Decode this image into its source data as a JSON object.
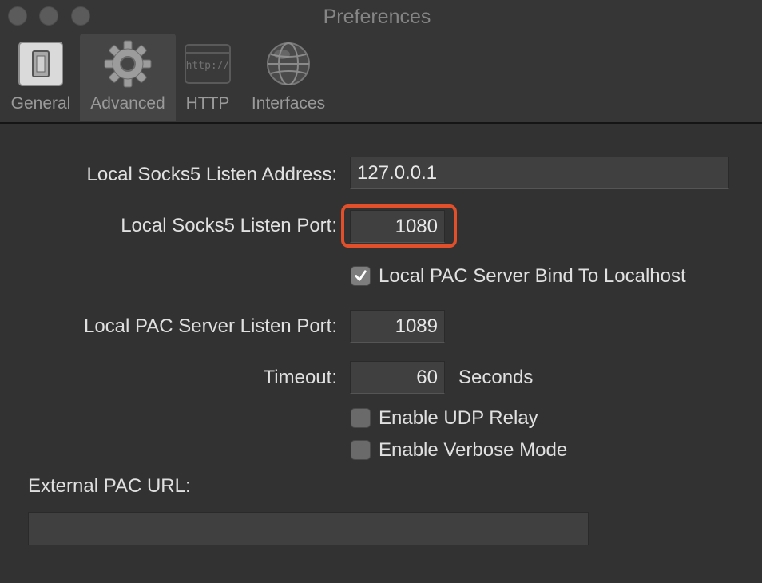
{
  "window": {
    "title": "Preferences"
  },
  "tabs": [
    {
      "label": "General",
      "icon": "toggle-switch-icon",
      "selected": false
    },
    {
      "label": "Advanced",
      "icon": "gear-icon",
      "selected": true
    },
    {
      "label": "HTTP",
      "icon": "http-window-icon",
      "selected": false
    },
    {
      "label": "Interfaces",
      "icon": "globe-icon",
      "selected": false
    }
  ],
  "form": {
    "socks_address_label": "Local Socks5 Listen Address:",
    "socks_address_value": "127.0.0.1",
    "socks_port_label": "Local Socks5 Listen Port:",
    "socks_port_value": "1080",
    "pac_bind_label": "Local PAC Server Bind To Localhost",
    "pac_bind_checked": true,
    "pac_port_label": "Local PAC Server Listen Port:",
    "pac_port_value": "1089",
    "timeout_label": "Timeout:",
    "timeout_value": "60",
    "timeout_unit": "Seconds",
    "udp_relay_label": "Enable UDP Relay",
    "udp_relay_checked": false,
    "verbose_label": "Enable Verbose Mode",
    "verbose_checked": false,
    "external_pac_label": "External PAC URL:",
    "external_pac_value": ""
  },
  "colors": {
    "highlight": "#e14f2b",
    "background": "#323232"
  }
}
